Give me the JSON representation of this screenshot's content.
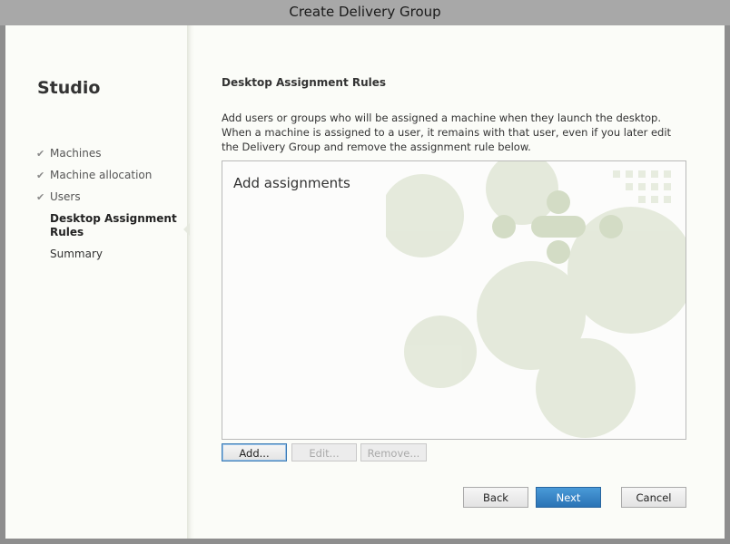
{
  "window": {
    "title": "Create Delivery Group"
  },
  "sidebar": {
    "app_name": "Studio",
    "steps": [
      {
        "label": "Machines",
        "done": true
      },
      {
        "label": "Machine allocation",
        "done": true
      },
      {
        "label": "Users",
        "done": true
      },
      {
        "label": "Desktop Assignment Rules",
        "active": true
      },
      {
        "label": "Summary"
      }
    ]
  },
  "main": {
    "section_title": "Desktop Assignment Rules",
    "description": "Add users or groups who will be assigned a machine when they launch the desktop. When a machine is assigned to a user, it remains with that user, even if you later edit the Delivery Group and remove the assignment rule below.",
    "panel_title": "Add assignments",
    "add_label": "Add...",
    "edit_label": "Edit...",
    "remove_label": "Remove..."
  },
  "footer": {
    "back_label": "Back",
    "next_label": "Next",
    "cancel_label": "Cancel"
  },
  "colors": {
    "primary": "#2a73b5",
    "background": "#fbfcf8",
    "watermark": "#e4e9dc"
  },
  "icons": {
    "step_done": "checkmark-icon"
  }
}
